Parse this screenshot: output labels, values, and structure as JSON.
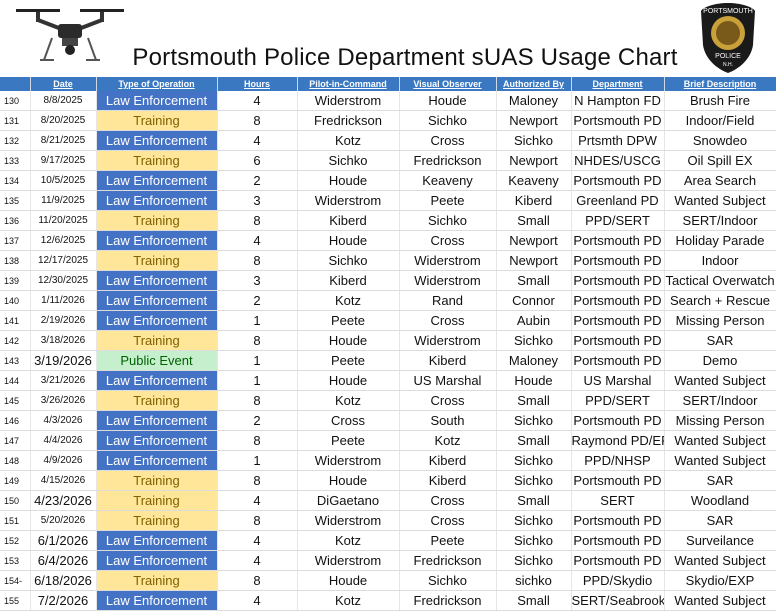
{
  "title": "Portsmouth Police Department sUAS Usage Chart",
  "badge": {
    "top_text": "PORTSMOUTH",
    "bottom_text": "POLICE",
    "sub_text": "N.H."
  },
  "colors": {
    "header_bg": "#3a78c2",
    "law_enforcement": "#4472c4",
    "training": "#ffe699",
    "public_event": "#c6efce"
  },
  "columns": [
    "",
    "Date",
    "Type of Operation",
    "Hours",
    "Pilot-in-Command",
    "Visual Observer",
    "Authorized By",
    "Department",
    "Brief Description"
  ],
  "rows": [
    {
      "n": "130",
      "date": "8/8/2025",
      "type": "Law Enforcement",
      "hours": "4",
      "pic": "Widerstrom",
      "vo": "Houde",
      "auth": "Maloney",
      "dept": "N Hampton FD",
      "desc": "Brush Fire"
    },
    {
      "n": "131",
      "date": "8/20/2025",
      "type": "Training",
      "hours": "8",
      "pic": "Fredrickson",
      "vo": "Sichko",
      "auth": "Newport",
      "dept": "Portsmouth PD",
      "desc": "Indoor/Field"
    },
    {
      "n": "132",
      "date": "8/21/2025",
      "type": "Law Enforcement",
      "hours": "4",
      "pic": "Kotz",
      "vo": "Cross",
      "auth": "Sichko",
      "dept": "Prtsmth DPW",
      "desc": "Snowdeo"
    },
    {
      "n": "133",
      "date": "9/17/2025",
      "type": "Training",
      "hours": "6",
      "pic": "Sichko",
      "vo": "Fredrickson",
      "auth": "Newport",
      "dept": "NHDES/USCG",
      "desc": "Oil Spill EX"
    },
    {
      "n": "134",
      "date": "10/5/2025",
      "type": "Law Enforcement",
      "hours": "2",
      "pic": "Houde",
      "vo": "Keaveny",
      "auth": "Keaveny",
      "dept": "Portsmouth PD",
      "desc": "Area Search"
    },
    {
      "n": "135",
      "date": "11/9/2025",
      "type": "Law Enforcement",
      "hours": "3",
      "pic": "Widerstrom",
      "vo": "Peete",
      "auth": "Kiberd",
      "dept": "Greenland PD",
      "desc": "Wanted Subject"
    },
    {
      "n": "136",
      "date": "11/20/2025",
      "type": "Training",
      "hours": "8",
      "pic": "Kiberd",
      "vo": "Sichko",
      "auth": "Small",
      "dept": "PPD/SERT",
      "desc": "SERT/Indoor"
    },
    {
      "n": "137",
      "date": "12/6/2025",
      "type": "Law Enforcement",
      "hours": "4",
      "pic": "Houde",
      "vo": "Cross",
      "auth": "Newport",
      "dept": "Portsmouth PD",
      "desc": "Holiday Parade"
    },
    {
      "n": "138",
      "date": "12/17/2025",
      "type": "Training",
      "hours": "8",
      "pic": "Sichko",
      "vo": "Widerstrom",
      "auth": "Newport",
      "dept": "Portsmouth PD",
      "desc": "Indoor"
    },
    {
      "n": "139",
      "date": "12/30/2025",
      "type": "Law Enforcement",
      "hours": "3",
      "pic": "Kiberd",
      "vo": "Widerstrom",
      "auth": "Small",
      "dept": "Portsmouth PD",
      "desc": "Tactical Overwatch"
    },
    {
      "n": "140",
      "date": "1/11/2026",
      "type": "Law Enforcement",
      "hours": "2",
      "pic": "Kotz",
      "vo": "Rand",
      "auth": "Connor",
      "dept": "Portsmouth PD",
      "desc": "Search + Rescue"
    },
    {
      "n": "141",
      "date": "2/19/2026",
      "type": "Law Enforcement",
      "hours": "1",
      "pic": "Peete",
      "vo": "Cross",
      "auth": "Aubin",
      "dept": "Portsmouth PD",
      "desc": "Missing Person"
    },
    {
      "n": "142",
      "date": "3/18/2026",
      "type": "Training",
      "hours": "8",
      "pic": "Houde",
      "vo": "Widerstrom",
      "auth": "Sichko",
      "dept": "Portsmouth PD",
      "desc": "SAR"
    },
    {
      "n": "143",
      "date": "3/19/2026",
      "type": "Public Event",
      "hours": "1",
      "pic": "Peete",
      "vo": "Kiberd",
      "auth": "Maloney",
      "dept": "Portsmouth PD",
      "desc": "Demo"
    },
    {
      "n": "144",
      "date": "3/21/2026",
      "type": "Law Enforcement",
      "hours": "1",
      "pic": "Houde",
      "vo": "US Marshal",
      "auth": "Houde",
      "dept": "US Marshal",
      "desc": "Wanted Subject"
    },
    {
      "n": "145",
      "date": "3/26/2026",
      "type": "Training",
      "hours": "8",
      "pic": "Kotz",
      "vo": "Cross",
      "auth": "Small",
      "dept": "PPD/SERT",
      "desc": "SERT/Indoor"
    },
    {
      "n": "146",
      "date": "4/3/2026",
      "type": "Law Enforcement",
      "hours": "2",
      "pic": "Cross",
      "vo": "South",
      "auth": "Sichko",
      "dept": "Portsmouth PD",
      "desc": "Missing Person"
    },
    {
      "n": "147",
      "date": "4/4/2026",
      "type": "Law Enforcement",
      "hours": "8",
      "pic": "Peete",
      "vo": "Kotz",
      "auth": "Small",
      "dept": "Raymond PD/ERT",
      "desc": "Wanted Subject"
    },
    {
      "n": "148",
      "date": "4/9/2026",
      "type": "Law Enforcement",
      "hours": "1",
      "pic": "Widerstrom",
      "vo": "Kiberd",
      "auth": "Sichko",
      "dept": "PPD/NHSP",
      "desc": "Wanted Subject"
    },
    {
      "n": "149",
      "date": "4/15/2026",
      "type": "Training",
      "hours": "8",
      "pic": "Houde",
      "vo": "Kiberd",
      "auth": "Sichko",
      "dept": "Portsmouth PD",
      "desc": "SAR"
    },
    {
      "n": "150",
      "date": "4/23/2026",
      "type": "Training",
      "hours": "4",
      "pic": "DiGaetano",
      "vo": "Cross",
      "auth": "Small",
      "dept": "SERT",
      "desc": "Woodland"
    },
    {
      "n": "151",
      "date": "5/20/2026",
      "type": "Training",
      "hours": "8",
      "pic": "Widerstrom",
      "vo": "Cross",
      "auth": "Sichko",
      "dept": "Portsmouth PD",
      "desc": "SAR"
    },
    {
      "n": "152",
      "date": "6/1/2026",
      "type": "Law Enforcement",
      "hours": "4",
      "pic": "Kotz",
      "vo": "Peete",
      "auth": "Sichko",
      "dept": "Portsmouth PD",
      "desc": "Surveilance"
    },
    {
      "n": "153",
      "date": "6/4/2026",
      "type": "Law Enforcement",
      "hours": "4",
      "pic": "Widerstrom",
      "vo": "Fredrickson",
      "auth": "Sichko",
      "dept": "Portsmouth PD",
      "desc": "Wanted Subject"
    },
    {
      "n": "154-",
      "date": "6/18/2026",
      "type": "Training",
      "hours": "8",
      "pic": "Houde",
      "vo": "Sichko",
      "auth": "sichko",
      "dept": "PPD/Skydio",
      "desc": "Skydio/EXP"
    },
    {
      "n": "155",
      "date": "7/2/2026",
      "type": "Law Enforcement",
      "hours": "4",
      "pic": "Kotz",
      "vo": "Fredrickson",
      "auth": "Small",
      "dept": "SERT/Seabrook",
      "desc": "Wanted Subject"
    }
  ]
}
